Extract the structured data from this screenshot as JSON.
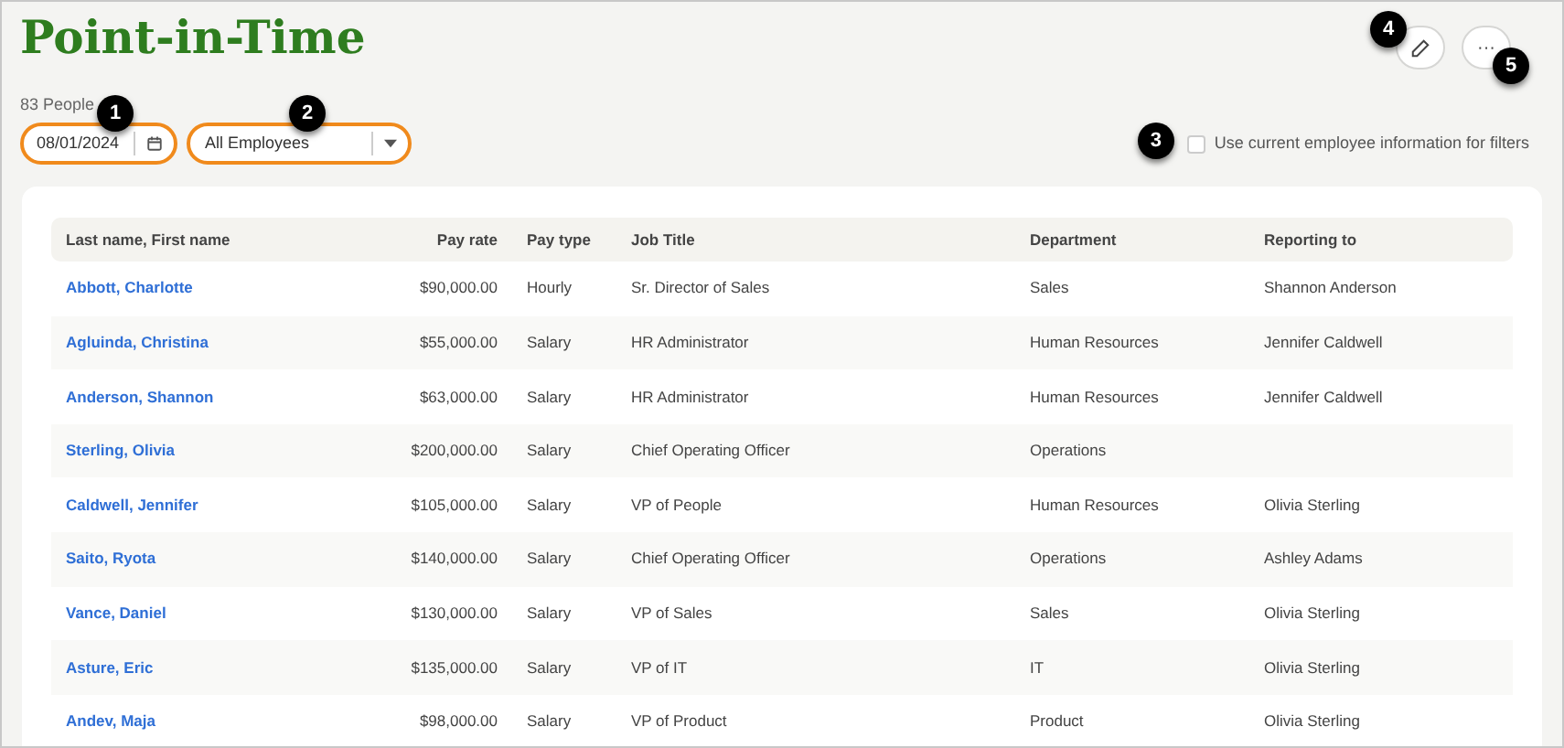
{
  "title": "Point-in-Time",
  "count": "83 People",
  "filters": {
    "date": {
      "value": "08/01/2024",
      "callout": "1"
    },
    "employees": {
      "value": "All Employees",
      "callout": "2"
    },
    "current_info": {
      "label": "Use current employee information for filters",
      "checked": false,
      "callout": "3"
    }
  },
  "actions": [
    {
      "kind": "edit",
      "callout": "4"
    },
    {
      "kind": "more",
      "label": "···",
      "callout": "5"
    }
  ],
  "table": {
    "columns": [
      "Last name, First name",
      "Pay rate",
      "Pay type",
      "Job Title",
      "Department",
      "Reporting to"
    ],
    "rows": [
      {
        "name": "Abbott, Charlotte",
        "pay_rate": "$90,000.00",
        "pay_type": "Hourly",
        "job_title": "Sr. Director of Sales",
        "department": "Sales",
        "reporting_to": "Shannon Anderson"
      },
      {
        "name": "Agluinda, Christina",
        "pay_rate": "$55,000.00",
        "pay_type": "Salary",
        "job_title": "HR Administrator",
        "department": "Human Resources",
        "reporting_to": "Jennifer Caldwell"
      },
      {
        "name": "Anderson, Shannon",
        "pay_rate": "$63,000.00",
        "pay_type": "Salary",
        "job_title": "HR Administrator",
        "department": "Human Resources",
        "reporting_to": "Jennifer Caldwell"
      },
      {
        "name": "Sterling, Olivia",
        "pay_rate": "$200,000.00",
        "pay_type": "Salary",
        "job_title": "Chief Operating Officer",
        "department": "Operations"
      },
      {
        "name": "Caldwell, Jennifer",
        "pay_rate": "$105,000.00",
        "pay_type": "Salary",
        "job_title": "VP of People",
        "department": "Human Resources",
        "reporting_to": "Olivia Sterling"
      },
      {
        "name": "Saito, Ryota",
        "pay_rate": "$140,000.00",
        "pay_type": "Salary",
        "job_title": "Chief Operating Officer",
        "department": "Operations",
        "reporting_to": "Ashley Adams"
      },
      {
        "name": "Vance, Daniel",
        "pay_rate": "$130,000.00",
        "pay_type": "Salary",
        "job_title": "VP of Sales",
        "department": "Sales",
        "reporting_to": "Olivia Sterling"
      },
      {
        "name": "Asture, Eric",
        "pay_rate": "$135,000.00",
        "pay_type": "Salary",
        "job_title": "VP of IT",
        "department": "IT",
        "reporting_to": "Olivia Sterling"
      },
      {
        "name": "Andev, Maja",
        "pay_rate": "$98,000.00",
        "pay_type": "Salary",
        "job_title": "VP of Product",
        "department": "Product",
        "reporting_to": "Olivia Sterling"
      }
    ]
  }
}
